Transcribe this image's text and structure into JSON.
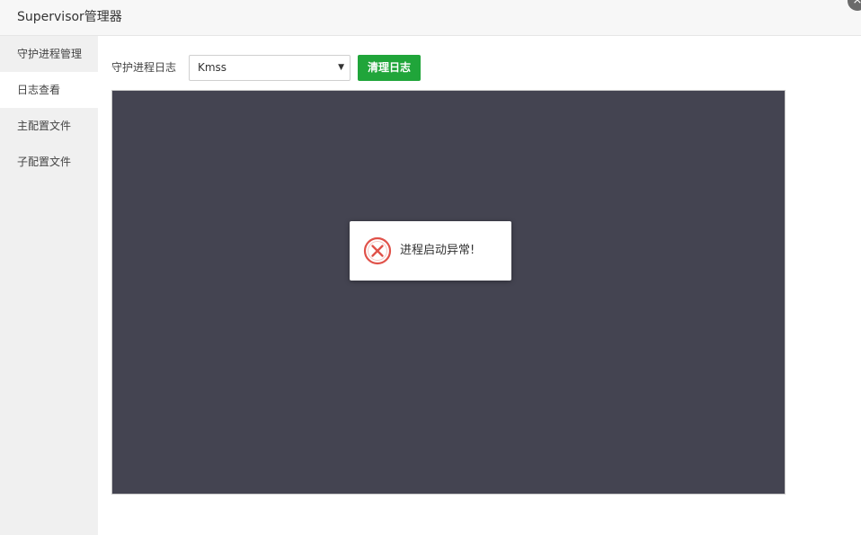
{
  "window": {
    "title": "Supervisor管理器",
    "close_symbol": "×"
  },
  "sidebar": {
    "items": [
      {
        "label": "守护进程管理",
        "active": false
      },
      {
        "label": "日志查看",
        "active": true
      },
      {
        "label": "主配置文件",
        "active": false
      },
      {
        "label": "子配置文件",
        "active": false
      }
    ]
  },
  "toolbar": {
    "label": "守护进程日志",
    "select_value": "Kmss",
    "clear_button": "清理日志"
  },
  "toast": {
    "message": "进程启动异常!",
    "icon": "error-circle-icon"
  },
  "colors": {
    "accent": "#20a53a",
    "log_background": "#444451",
    "error": "#e0524a"
  }
}
